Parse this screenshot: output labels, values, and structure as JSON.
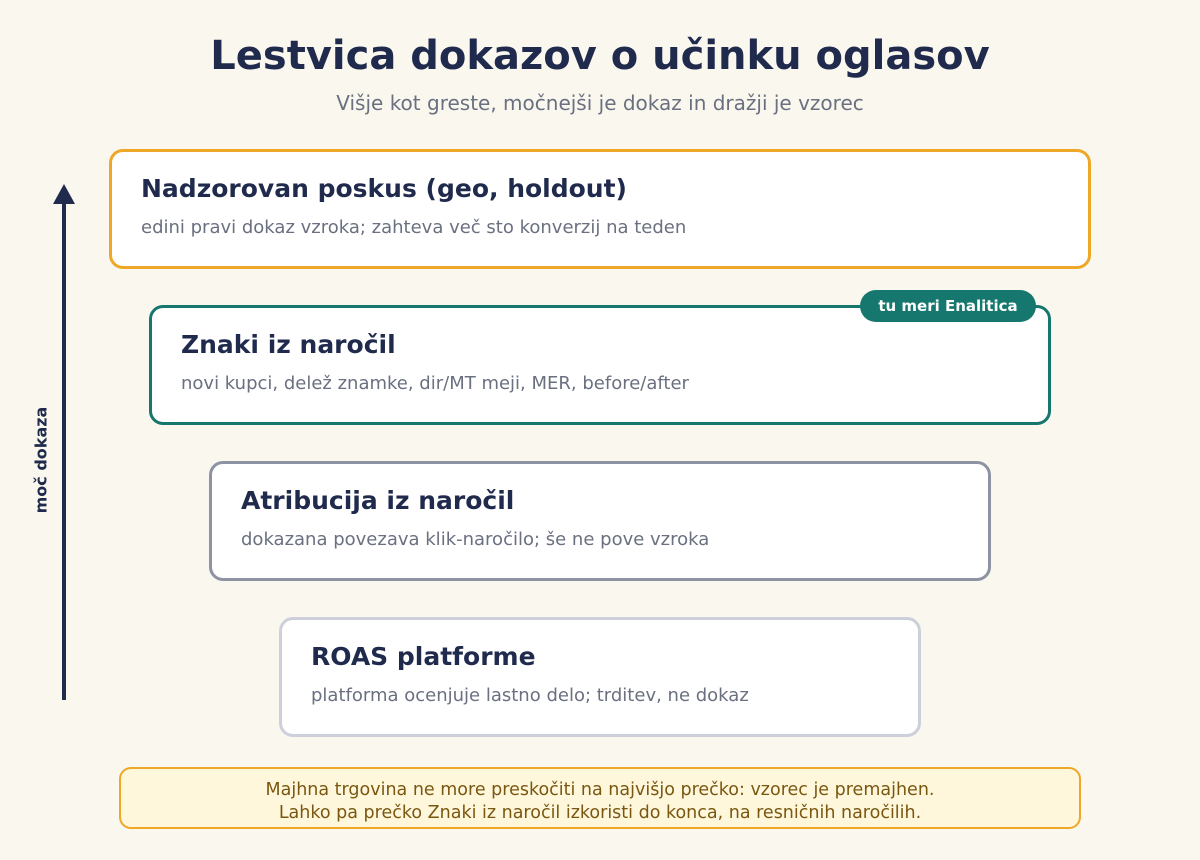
{
  "header": {
    "title": "Lestvica dokazov o učinku oglasov",
    "subtitle": "Višje kot greste, močnejši je dokaz in dražji je vzorec"
  },
  "axis": {
    "label": "moč dokaza"
  },
  "ladder": {
    "rungs": [
      {
        "title": "Nadzorovan poskus (geo, holdout)",
        "description": "edini pravi dokaz vzroka; zahteva več sto konverzij na teden",
        "border_color": "#eea726"
      },
      {
        "title": "Znaki iz naročil",
        "description": "novi kupci, delež znamke, dir/MT meji, MER, before/after",
        "border_color": "#15776e"
      },
      {
        "title": "Atribucija iz naročil",
        "description": "dokazana povezava klik-naročilo; še ne pove vzroka",
        "border_color": "#8d93a3"
      },
      {
        "title": "ROAS platforme",
        "description": "platforma ocenjuje lastno delo; trditev, ne dokaz",
        "border_color": "#cdd0da"
      }
    ],
    "badge": "tu meri Enalitica"
  },
  "note": {
    "line1": "Majhna trgovina ne more preskočiti na najvišjo prečko: vzorec je premajhen.",
    "line2": "Lahko pa prečko Znaki iz naročil izkoristi do konca, na resničnih naročilih."
  },
  "colors": {
    "background": "#faf7ef",
    "navy": "#1f2a4d",
    "accent_orange": "#eea726",
    "accent_teal": "#15776e"
  }
}
